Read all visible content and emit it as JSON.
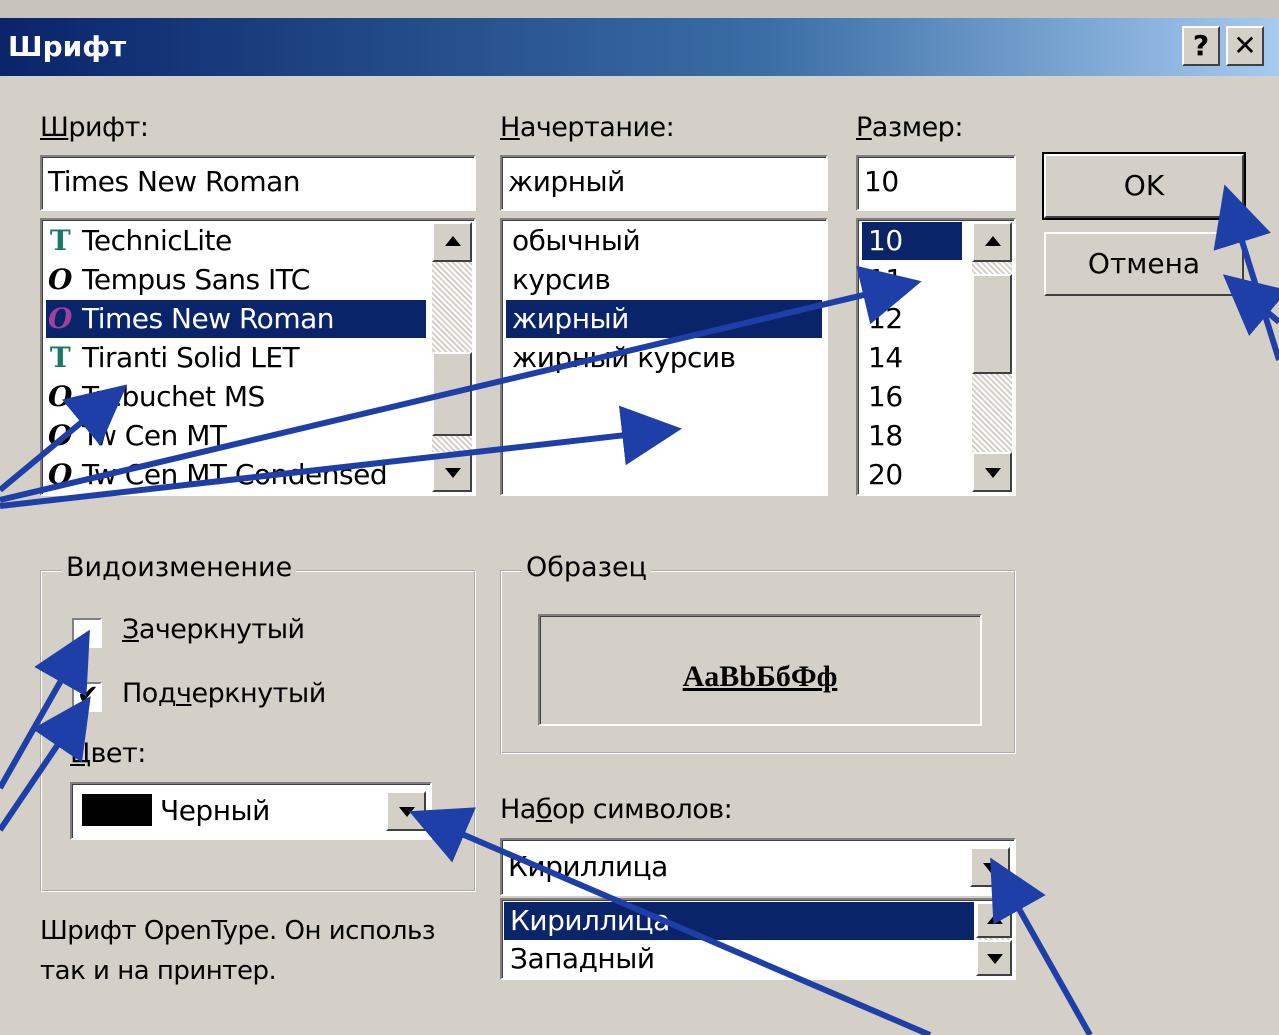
{
  "window": {
    "title": "Шрифт",
    "help_label": "?",
    "close_label": "✕"
  },
  "font": {
    "label_u": "Ш",
    "label_rest": "рифт:",
    "value": "Times New Roman",
    "items": [
      {
        "name": "TechnicLite",
        "icon": "truetype-icon"
      },
      {
        "name": "Tempus Sans ITC",
        "icon": "opentype-icon"
      },
      {
        "name": "Times New Roman",
        "icon": "opentype-icon"
      },
      {
        "name": "Tiranti Solid LET",
        "icon": "truetype-icon"
      },
      {
        "name": "Trebuchet MS",
        "icon": "opentype-icon"
      },
      {
        "name": "Tw Cen MT",
        "icon": "opentype-icon"
      },
      {
        "name": "Tw Cen MT Condensed",
        "icon": "opentype-icon"
      }
    ],
    "selected_index": 2
  },
  "style": {
    "label_u": "Н",
    "label_rest": "ачертание:",
    "value": "жирный",
    "items": [
      "обычный",
      "курсив",
      "жирный",
      "жирный курсив"
    ],
    "selected_index": 2
  },
  "size": {
    "label_u": "Р",
    "label_rest": "азмер:",
    "value": "10",
    "items": [
      "10",
      "11",
      "12",
      "14",
      "16",
      "18",
      "20"
    ],
    "selected_index": 0
  },
  "buttons": {
    "ok": "OK",
    "cancel": "Отмена"
  },
  "effects": {
    "title": "Видоизменение",
    "strikeout_u": "З",
    "strikeout_rest": "ачеркнутый",
    "strikeout_checked": false,
    "underline_pre": "Под",
    "underline_u": "ч",
    "underline_rest": "еркнутый",
    "underline_checked": true,
    "color_label_u": "Ц",
    "color_label_rest": "вет:",
    "color_value": "Черный",
    "color_hex": "#000000"
  },
  "sample": {
    "title": "Образец",
    "text": "AaBbБбФф"
  },
  "charset": {
    "label_pre": "На",
    "label_u": "б",
    "label_rest": "ор символов:",
    "value": "Кириллица",
    "options": [
      "Кириллица",
      "Западный"
    ],
    "selected_index": 0
  },
  "description": {
    "line1": "Шрифт OpenType. Он использ",
    "line2": "так и на принтер."
  },
  "colors": {
    "selection": "#0a246a",
    "arrow": "#1f3fa8",
    "face": "#d4d0c8"
  }
}
